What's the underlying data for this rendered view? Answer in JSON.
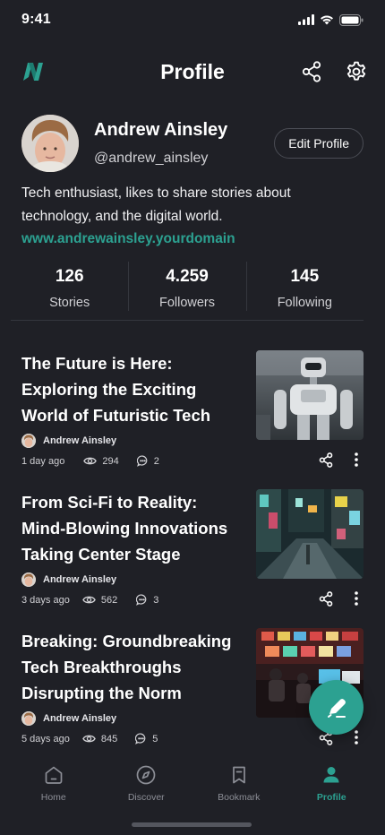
{
  "status_bar": {
    "time": "9:41"
  },
  "app_bar": {
    "title": "Profile"
  },
  "profile": {
    "name": "Andrew Ainsley",
    "handle": "@andrew_ainsley",
    "edit_label": "Edit Profile",
    "bio": "Tech enthusiast, likes to share stories about technology, and the digital world.",
    "website": "www.andrewainsley.yourdomain"
  },
  "stats": [
    {
      "value": "126",
      "label": "Stories"
    },
    {
      "value": "4.259",
      "label": "Followers"
    },
    {
      "value": "145",
      "label": "Following"
    }
  ],
  "articles": [
    {
      "title": "The Future is Here: Exploring the Exciting World of Futuristic Tech",
      "author": "Andrew Ainsley",
      "time": "1 day ago",
      "views": "294",
      "comments": "2",
      "thumbnail": "robot-photo"
    },
    {
      "title": "From Sci-Fi to Reality: Mind-Blowing Innovations Taking Center Stage",
      "author": "Andrew Ainsley",
      "time": "3 days ago",
      "views": "562",
      "comments": "3",
      "thumbnail": "city-street-night-photo"
    },
    {
      "title": "Breaking: Groundbreaking Tech Breakthroughs Disrupting the Norm",
      "author": "Andrew Ainsley",
      "time": "5 days ago",
      "views": "845",
      "comments": "5",
      "thumbnail": "control-room-photo"
    }
  ],
  "bottom_nav": [
    {
      "label": "Home",
      "icon": "home-icon"
    },
    {
      "label": "Discover",
      "icon": "compass-icon"
    },
    {
      "label": "Bookmark",
      "icon": "bookmark-icon"
    },
    {
      "label": "Profile",
      "icon": "person-icon",
      "active": true
    }
  ],
  "colors": {
    "accent": "#2ca191",
    "background": "#1f2026",
    "muted": "#8c8e96"
  }
}
